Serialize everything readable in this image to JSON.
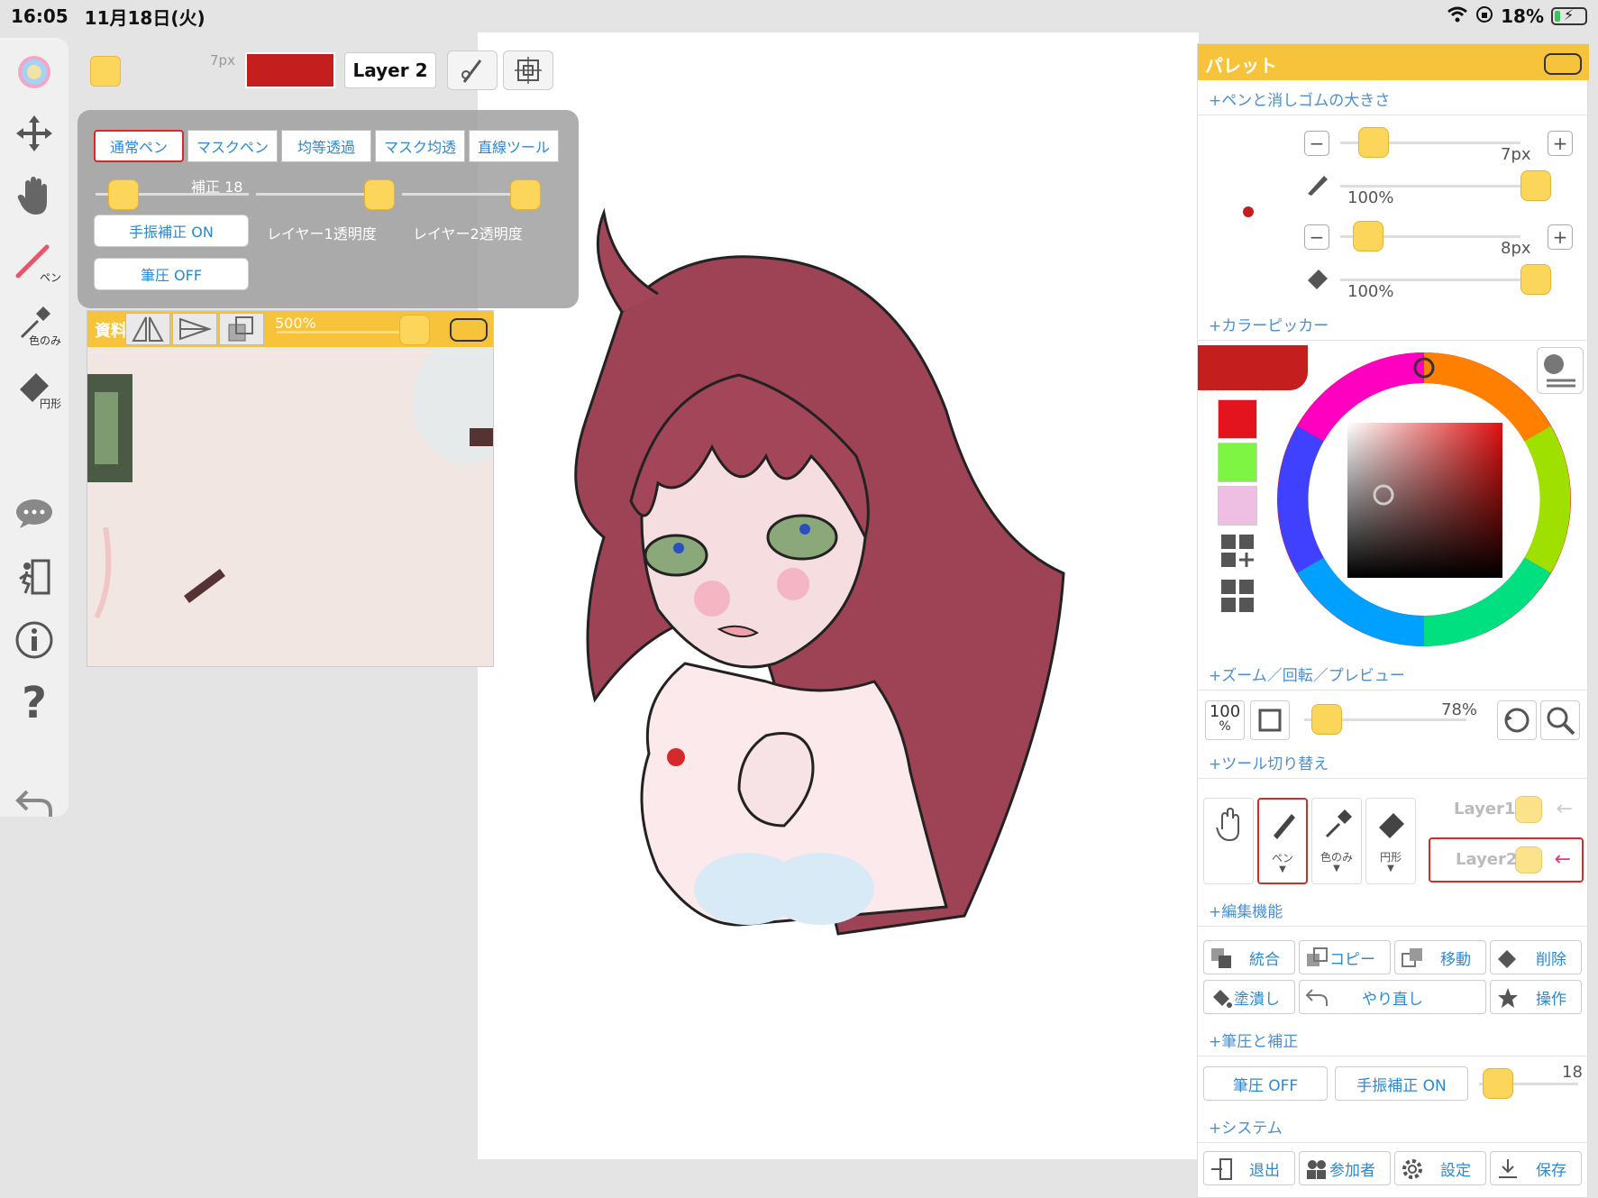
{
  "status": {
    "time": "16:05",
    "date": "11月18日(火)",
    "battery": "18%",
    "battery_level": 0.18
  },
  "left_toolbar": {
    "items": [
      {
        "name": "color-wheel"
      },
      {
        "name": "move"
      },
      {
        "name": "hand"
      },
      {
        "name": "pen",
        "label": "ペン"
      },
      {
        "name": "eyedropper",
        "label": "色のみ"
      },
      {
        "name": "eraser",
        "label": "円形"
      },
      {
        "name": "chat"
      },
      {
        "name": "exit"
      },
      {
        "name": "info"
      },
      {
        "name": "help"
      },
      {
        "name": "undo"
      }
    ]
  },
  "topbar": {
    "size_label": "7px",
    "current_color": "#c41e1e",
    "layer_label": "Layer 2"
  },
  "pen_panel": {
    "tabs": [
      "通常ペン",
      "マスクペン",
      "均等透過",
      "マスク均透",
      "直線ツール"
    ],
    "active_tab": 0,
    "correction_label": "補正 18",
    "stabilizer_button": "手振補正 ON",
    "pressure_button": "筆圧 OFF",
    "layer1_opacity_label": "レイヤー1透明度",
    "layer2_opacity_label": "レイヤー2透明度"
  },
  "reference_window": {
    "title": "資料画像",
    "zoom": "500%"
  },
  "palette": {
    "title": "パレット",
    "sections": {
      "pen_eraser_size": "+ペンと消しゴムの大きさ",
      "color_picker": "+カラーピッカー",
      "zoom": "+ズーム／回転／プレビュー",
      "tool_switch": "+ツール切り替え",
      "edit": "+編集機能",
      "pressure": "+筆圧と補正",
      "system": "+システム"
    },
    "pen_size": "7px",
    "pen_opacity": "100%",
    "eraser_size": "8px",
    "eraser_opacity": "100%",
    "swatches": [
      "#e4141f",
      "#7ef542",
      "#eebfe3"
    ],
    "zoom_100_label": "100",
    "zoom_pct_sub": "%",
    "zoom_value": "78%",
    "tool_cells": [
      {
        "name": "hand",
        "label": ""
      },
      {
        "name": "pen",
        "label": "ペン"
      },
      {
        "name": "eyedropper",
        "label": "色のみ"
      },
      {
        "name": "eraser",
        "label": "円形"
      }
    ],
    "layers": [
      "Layer1",
      "Layer2"
    ],
    "active_layer": 1,
    "edit_buttons_row1": [
      "統合",
      "コピー",
      "移動",
      "削除"
    ],
    "edit_buttons_row2": [
      "塗潰し",
      "やり直し",
      "操作"
    ],
    "pressure_button": "筆圧 OFF",
    "stabilizer_button": "手振補正 ON",
    "stabilizer_value": "18",
    "system_buttons": [
      "退出",
      "参加者",
      "設定",
      "保存"
    ]
  }
}
